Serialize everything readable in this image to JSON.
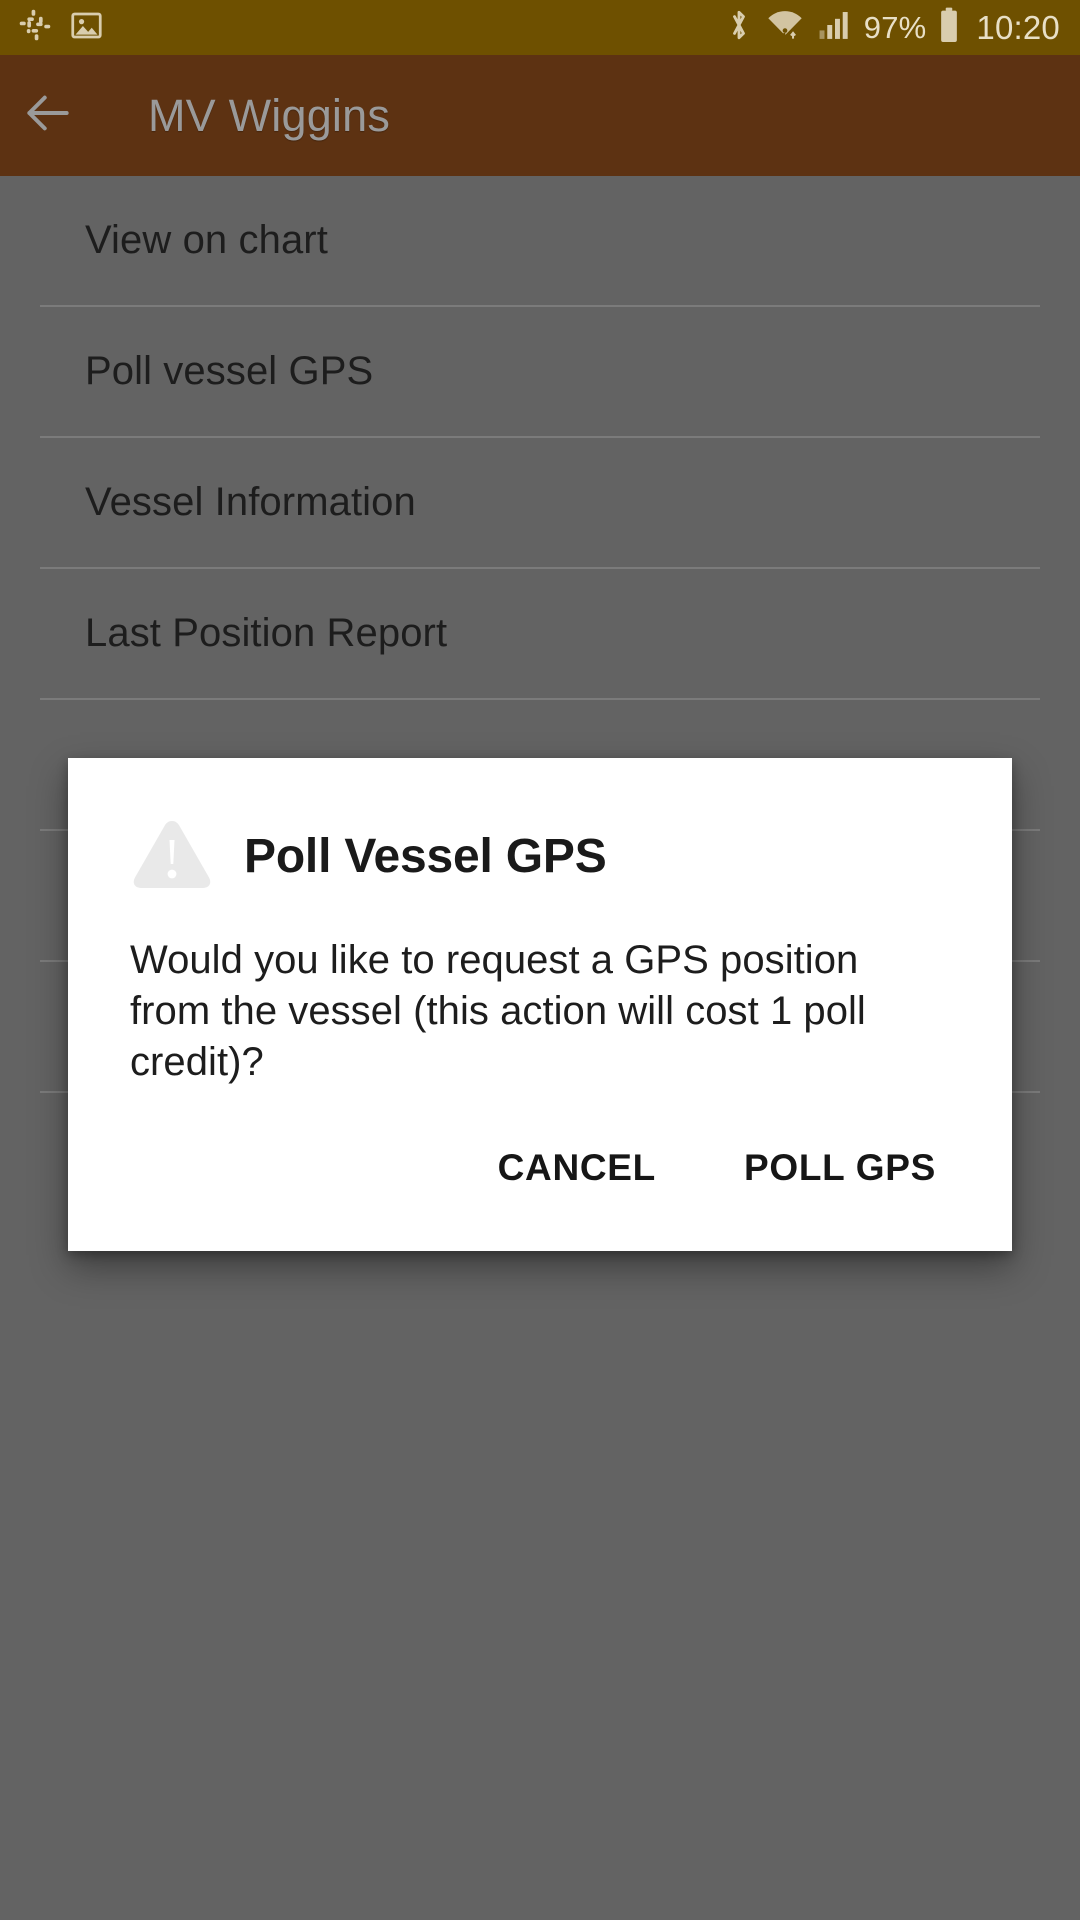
{
  "status_bar": {
    "background": "#6e5000",
    "left_icons": [
      {
        "name": "slack-icon"
      },
      {
        "name": "image-icon"
      }
    ],
    "right_icons": [
      {
        "name": "bluetooth-icon"
      },
      {
        "name": "wifi-icon"
      },
      {
        "name": "cellular-signal-icon"
      }
    ],
    "battery_percent": "97%",
    "battery_icon": "battery-icon",
    "clock": "10:20"
  },
  "app_bar": {
    "background": "#5d3212",
    "back_icon": "back-arrow-icon",
    "title": "MV Wiggins"
  },
  "content": {
    "scrim_color": "#636363",
    "items": [
      {
        "label": "View on chart"
      },
      {
        "label": "Poll vessel GPS"
      },
      {
        "label": "Vessel Information"
      },
      {
        "label": "Last Position Report"
      },
      {
        "label": ""
      },
      {
        "label": ""
      },
      {
        "label": ""
      }
    ]
  },
  "dialog": {
    "icon": "warning-triangle-icon",
    "title": "Poll Vessel GPS",
    "message": "Would you like to request a GPS position from the vessel (this action will cost 1 poll credit)?",
    "cancel_label": "CANCEL",
    "confirm_label": "POLL GPS"
  }
}
